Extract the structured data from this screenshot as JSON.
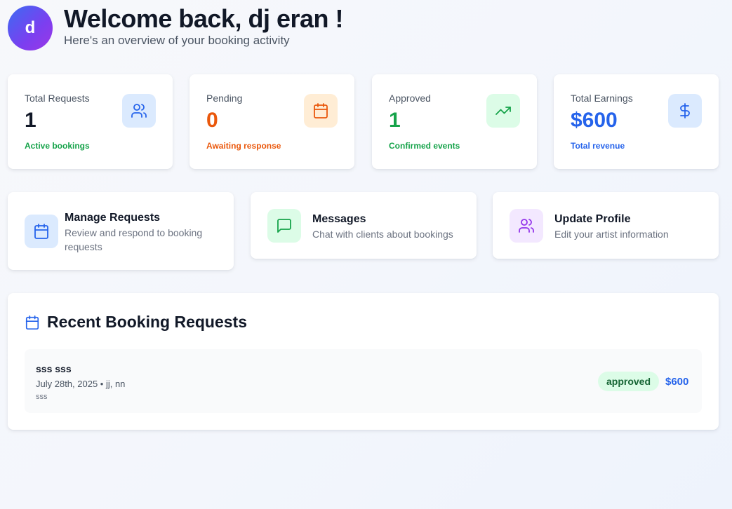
{
  "header": {
    "avatar_letter": "d",
    "welcome": "Welcome back, dj eran !",
    "subtitle": "Here's an overview of your booking activity"
  },
  "stats": [
    {
      "label": "Total Requests",
      "value": "1",
      "note": "Active bookings",
      "icon": "users-icon",
      "value_color": "#111827",
      "note_color": "#16a34a",
      "icon_bg": "#dbeafe",
      "icon_color": "#2563eb"
    },
    {
      "label": "Pending",
      "value": "0",
      "note": "Awaiting response",
      "icon": "calendar-icon",
      "value_color": "#ea580c",
      "note_color": "#ea580c",
      "icon_bg": "#ffedd5",
      "icon_color": "#ea580c"
    },
    {
      "label": "Approved",
      "value": "1",
      "note": "Confirmed events",
      "icon": "trending-up-icon",
      "value_color": "#16a34a",
      "note_color": "#16a34a",
      "icon_bg": "#dcfce7",
      "icon_color": "#16a34a"
    },
    {
      "label": "Total Earnings",
      "value": "$600",
      "note": "Total revenue",
      "icon": "dollar-icon",
      "value_color": "#2563eb",
      "note_color": "#2563eb",
      "icon_bg": "#dbeafe",
      "icon_color": "#2563eb"
    }
  ],
  "actions": [
    {
      "title": "Manage Requests",
      "desc": "Review and respond to booking requests",
      "icon": "calendar-icon",
      "icon_bg": "#dbeafe",
      "icon_color": "#2563eb"
    },
    {
      "title": "Messages",
      "desc": "Chat with clients about bookings",
      "icon": "message-icon",
      "icon_bg": "#dcfce7",
      "icon_color": "#16a34a"
    },
    {
      "title": "Update Profile",
      "desc": "Edit your artist information",
      "icon": "users-icon",
      "icon_bg": "#f3e8ff",
      "icon_color": "#9333ea"
    }
  ],
  "recent": {
    "title": "Recent Booking Requests",
    "icon": "calendar-icon",
    "icon_color": "#2563eb",
    "bookings": [
      {
        "name": "sss sss",
        "date_line": "July 28th, 2025 • jj, nn",
        "note": "sss",
        "status": "approved",
        "price": "$600"
      }
    ]
  }
}
